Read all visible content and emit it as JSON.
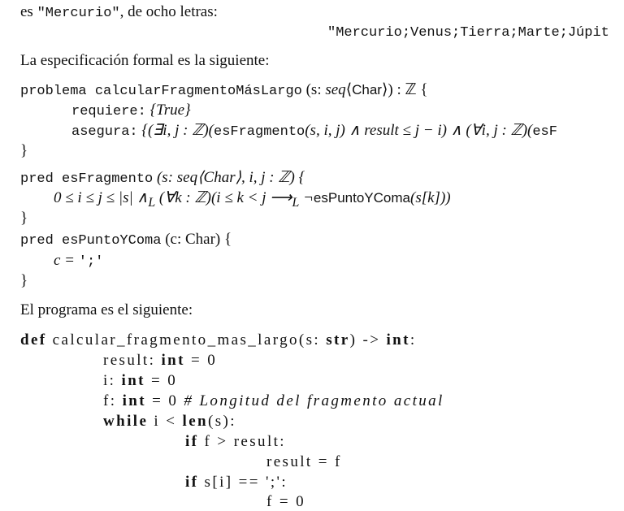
{
  "intro": {
    "prefix": "es ",
    "word": "\"Mercurio\"",
    "suffix": ", de ocho letras:",
    "example": "\"Mercurio;Venus;Tierra;Marte;Júpit"
  },
  "spec_intro": "La especificación formal es la siguiente:",
  "problema": {
    "kw": "problema calcularFragmentoMásLargo",
    "sig1": " (s: ",
    "seq": "seq",
    "sig2": "⟨",
    "char": "Char",
    "sig3": "⟩) : ℤ  {",
    "req_kw": "requiere:",
    "req": " {True}",
    "ens_kw": "asegura:",
    "ens1": " {(∃i, j : ℤ)(",
    "ens_fn": "esFragmento",
    "ens2": "(s, i, j) ∧ result ≤ j − i) ∧ (∀i, j : ℤ)(",
    "ens_fn2": "esF",
    "close": "}"
  },
  "pred1": {
    "kw": "pred esFragmento",
    "sig": " (s: seq⟨Char⟩, i, j : ℤ) {",
    "body1": "0 ≤ i ≤ j ≤ |s| ∧",
    "L1": "L",
    "body2": " (∀k : ℤ)(i ≤ k < j ⟶",
    "L2": "L",
    "body3": " ¬",
    "fn": "esPuntoYComa",
    "body4": "(s[k]))",
    "close": "}"
  },
  "pred2": {
    "kw": "pred esPuntoYComa",
    "sig": " (c: Char) {",
    "body": "c = ",
    "lit": "';'",
    "close": "}"
  },
  "prog_intro": "El programa es el siguiente:",
  "code": [
    {
      "kw": "def",
      "text": " calcular_fragmento_mas_largo(s: ",
      "kw2": "str",
      "text2": ") -> ",
      "kw3": "int",
      "text3": ":"
    },
    {
      "kw": "",
      "text": "result: ",
      "kw2": "int",
      "text2": " = 0",
      "kw3": "",
      "text3": ""
    },
    {
      "kw": "",
      "text": "i: ",
      "kw2": "int",
      "text2": " = 0",
      "kw3": "",
      "text3": ""
    },
    {
      "kw": "",
      "text": "f: ",
      "kw2": "int",
      "text2": " = 0 ",
      "comment": "# Longitud del fragmento actual"
    },
    {
      "kw": "while",
      "text": " i < ",
      "kw2": "len",
      "text2": "(s):",
      "kw3": "",
      "text3": ""
    },
    {
      "kw": "if",
      "text": " f > result:",
      "kw2": "",
      "text2": "",
      "kw3": "",
      "text3": ""
    },
    {
      "kw": "",
      "text": "result = f",
      "kw2": "",
      "text2": "",
      "kw3": "",
      "text3": ""
    },
    {
      "kw": "if",
      "text": " s[i] == ';':",
      "kw2": "",
      "text2": "",
      "kw3": "",
      "text3": ""
    },
    {
      "kw": "",
      "text": "f = 0",
      "kw2": "",
      "text2": "",
      "kw3": "",
      "text3": ""
    }
  ]
}
